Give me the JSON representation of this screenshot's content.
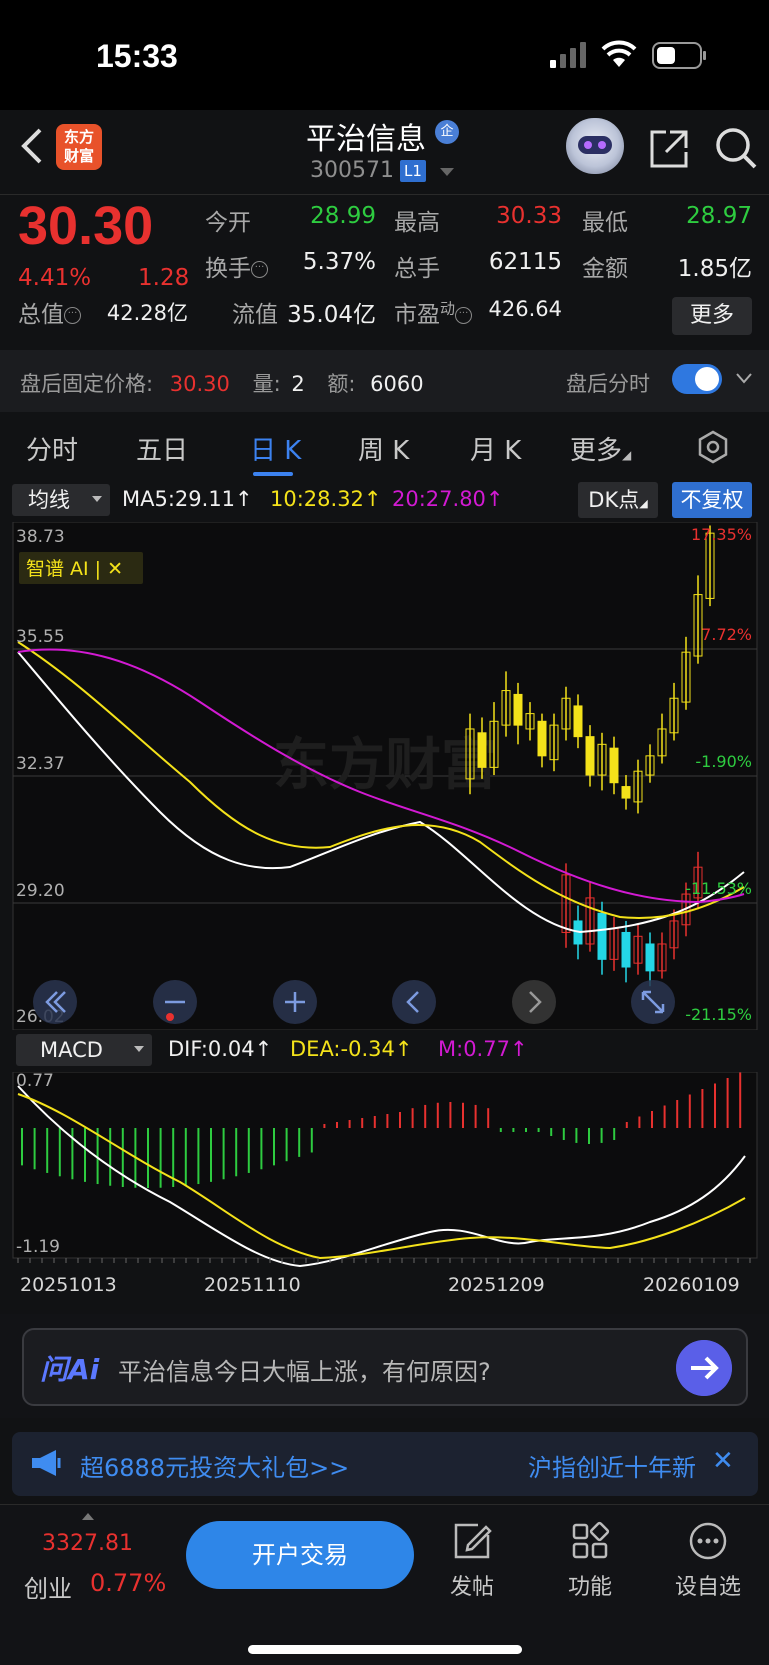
{
  "status_bar": {
    "time": "15:33"
  },
  "header": {
    "logo_text": "东方\n财富",
    "stock_name": "平治信息",
    "reg_badge": "企",
    "stock_code": "300571",
    "level_badge": "L1"
  },
  "quote": {
    "price": "30.30",
    "change_pct": "4.41%",
    "change_amt": "1.28",
    "fields": {
      "open_label": "今开",
      "open": "28.99",
      "high_label": "最高",
      "high": "30.33",
      "low_label": "最低",
      "low": "28.97",
      "turnover_label": "换手",
      "turnover": "5.37%",
      "volume_label": "总手",
      "volume": "62115",
      "amount_label": "金额",
      "amount": "1.85亿",
      "mktcap_label": "总值",
      "mktcap": "42.28亿",
      "float_label": "流值",
      "float_cap": "35.04亿",
      "pe_label": "市盈",
      "pe_sup": "动",
      "pe": "426.64"
    },
    "more_label": "更多"
  },
  "after_hours": {
    "price_label": "盘后固定价格:",
    "price": "30.30",
    "vol_label": "量:",
    "vol": "2",
    "amt_label": "额:",
    "amt": "6060",
    "toggle_label": "盘后分时",
    "toggle_on": true
  },
  "tabs": [
    {
      "label": "分时"
    },
    {
      "label": "五日"
    },
    {
      "label": "日 K"
    },
    {
      "label": "周 K"
    },
    {
      "label": "月 K"
    },
    {
      "label": "更多"
    }
  ],
  "active_tab": "日 K",
  "ma_bar": {
    "select": "均线",
    "ma5": "MA5:29.11↑",
    "ma10": "10:28.32↑",
    "ma20": "20:27.80↑",
    "dk_label": "DK点",
    "fq_label": "不复权"
  },
  "colors": {
    "up": "#e8312f",
    "down": "#24d6e6",
    "yang": "#f4e21a",
    "ma5": "#ffffff",
    "ma10": "#f4e21a",
    "ma20": "#d21ad2",
    "accent": "#2f78e0"
  },
  "kline_chart": {
    "price_labels": [
      "38.73",
      "35.55",
      "32.37",
      "29.20",
      "26.02"
    ],
    "pct_labels": [
      "17.35%",
      "7.72%",
      "-1.90%",
      "-11.53%",
      "-21.15%"
    ],
    "ai_tag": "智谱 AI | ✕",
    "watermark": "东方财富",
    "nav_icons": [
      "double-left-icon",
      "zoom-out-icon",
      "zoom-in-icon",
      "left-icon",
      "right-icon",
      "fullscreen-icon"
    ]
  },
  "macd": {
    "select": "MACD",
    "dif": "DIF:0.04↑",
    "dea": "DEA:-0.34↑",
    "m": "M:0.77↑",
    "top_label": "0.77",
    "bottom_label": "-1.19"
  },
  "dates": [
    "20251013",
    "20251110",
    "20251209",
    "20260109"
  ],
  "chart_data": {
    "type": "candlestick",
    "ylim": [
      26.02,
      38.73
    ],
    "lower_series": [
      {
        "o": 28.3,
        "c": 29.8,
        "h": 30.1,
        "l": 27.9
      },
      {
        "o": 28.6,
        "c": 28.0,
        "h": 29.0,
        "l": 27.6
      },
      {
        "o": 28.0,
        "c": 29.2,
        "h": 29.6,
        "l": 27.8
      },
      {
        "o": 28.8,
        "c": 27.6,
        "h": 29.1,
        "l": 27.2
      },
      {
        "o": 27.6,
        "c": 28.4,
        "h": 28.7,
        "l": 27.3
      },
      {
        "o": 28.3,
        "c": 27.4,
        "h": 28.6,
        "l": 27.0
      },
      {
        "o": 27.5,
        "c": 28.2,
        "h": 28.5,
        "l": 27.2
      },
      {
        "o": 28.0,
        "c": 27.3,
        "h": 28.3,
        "l": 26.9
      },
      {
        "o": 27.3,
        "c": 28.0,
        "h": 28.3,
        "l": 27.1
      },
      {
        "o": 27.9,
        "c": 28.6,
        "h": 28.9,
        "l": 27.6
      },
      {
        "o": 28.5,
        "c": 29.3,
        "h": 29.6,
        "l": 28.2
      },
      {
        "o": 29.2,
        "c": 30.0,
        "h": 30.4,
        "l": 28.9
      }
    ],
    "upper_series": [
      {
        "o": 32.3,
        "c": 33.6,
        "h": 34.0,
        "l": 31.9
      },
      {
        "o": 33.5,
        "c": 32.6,
        "h": 33.9,
        "l": 32.3
      },
      {
        "o": 32.6,
        "c": 33.8,
        "h": 34.3,
        "l": 32.4
      },
      {
        "o": 33.7,
        "c": 34.6,
        "h": 35.1,
        "l": 33.4
      },
      {
        "o": 34.5,
        "c": 33.7,
        "h": 34.8,
        "l": 33.2
      },
      {
        "o": 33.6,
        "c": 34.0,
        "h": 34.3,
        "l": 33.3
      },
      {
        "o": 33.8,
        "c": 32.9,
        "h": 34.0,
        "l": 32.6
      },
      {
        "o": 32.8,
        "c": 33.7,
        "h": 34.0,
        "l": 32.5
      },
      {
        "o": 33.6,
        "c": 34.4,
        "h": 34.7,
        "l": 33.3
      },
      {
        "o": 34.2,
        "c": 33.4,
        "h": 34.5,
        "l": 33.1
      },
      {
        "o": 33.4,
        "c": 32.4,
        "h": 33.7,
        "l": 32.1
      },
      {
        "o": 32.4,
        "c": 33.2,
        "h": 33.5,
        "l": 32.0
      },
      {
        "o": 33.1,
        "c": 32.2,
        "h": 33.4,
        "l": 31.9
      },
      {
        "o": 32.1,
        "c": 31.8,
        "h": 32.4,
        "l": 31.5
      },
      {
        "o": 31.7,
        "c": 32.5,
        "h": 32.8,
        "l": 31.4
      },
      {
        "o": 32.4,
        "c": 32.9,
        "h": 33.2,
        "l": 32.2
      },
      {
        "o": 32.9,
        "c": 33.6,
        "h": 34.0,
        "l": 32.7
      },
      {
        "o": 33.5,
        "c": 34.4,
        "h": 34.8,
        "l": 33.3
      },
      {
        "o": 34.3,
        "c": 35.6,
        "h": 36.0,
        "l": 34.1
      },
      {
        "o": 35.5,
        "c": 37.1,
        "h": 37.6,
        "l": 35.3
      },
      {
        "o": 37.0,
        "c": 38.7,
        "h": 38.9,
        "l": 36.8
      }
    ]
  }
}
